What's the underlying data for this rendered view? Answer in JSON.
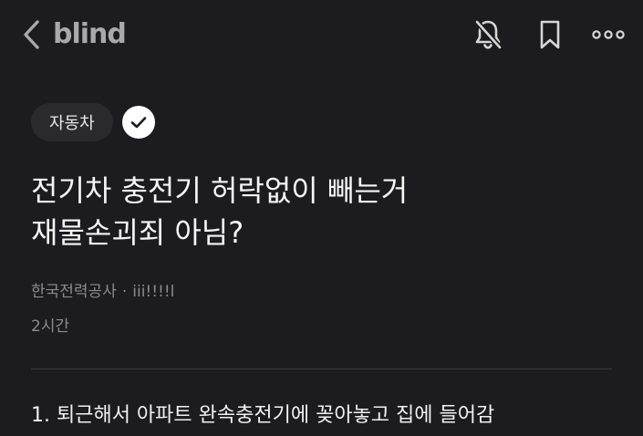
{
  "header": {
    "logo": "blind",
    "icons": [
      "back-icon",
      "bell-off-icon",
      "bookmark-icon",
      "more-icon"
    ]
  },
  "post": {
    "category": "자동차",
    "title_line1": "전기차 충전기 허락없이 빼는거",
    "title_line2": "재물손괴죄 아님?",
    "company": "한국전력공사",
    "separator": "·",
    "nickname": "iii!!!!l",
    "time": "2시간",
    "body_line1": "1. 퇴근해서 아파트 완속충전기에 꽂아놓고 집에 들어감"
  },
  "colors": {
    "background": "#1c1b1f",
    "text": "#f2f2f2",
    "muted": "#8b8a90",
    "chip_bg": "#2a292e"
  }
}
